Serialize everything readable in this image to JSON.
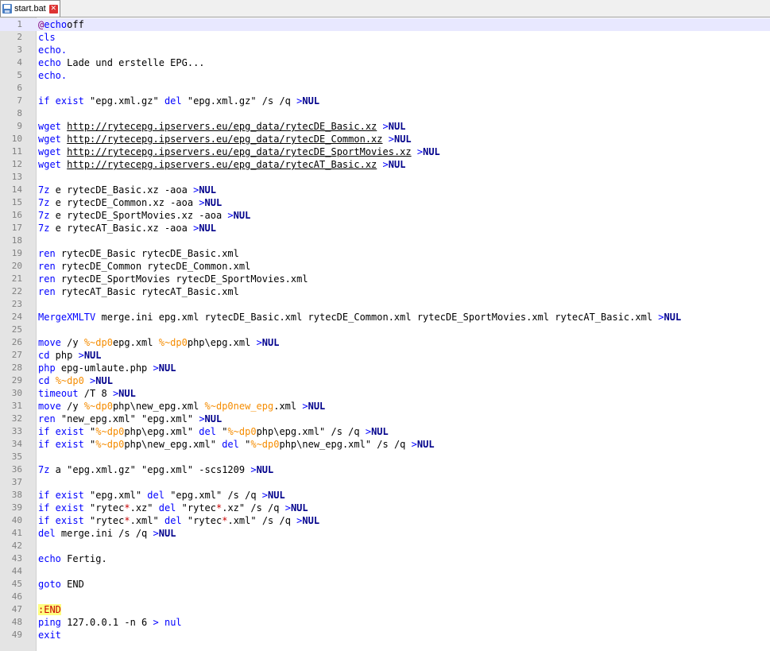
{
  "tab": {
    "label": "start.bat",
    "icon": "save-disk-icon",
    "close_icon": "close-icon"
  },
  "colors": {
    "command": "#0000ff",
    "keyword": "#00008b",
    "variable": "#f58c00",
    "label": "#c80000",
    "line_number": "#808080"
  },
  "current_line": 1,
  "lines": [
    {
      "n": "1",
      "t": [
        [
          "at",
          "@"
        ],
        [
          "kw",
          "echo"
        ],
        [
          "",
          "off"
        ]
      ]
    },
    {
      "n": "2",
      "t": [
        [
          "kw",
          "cls"
        ]
      ]
    },
    {
      "n": "3",
      "t": [
        [
          "kw",
          "echo."
        ]
      ]
    },
    {
      "n": "4",
      "t": [
        [
          "kw",
          "echo"
        ],
        [
          "",
          " Lade und erstelle EPG..."
        ]
      ]
    },
    {
      "n": "5",
      "t": [
        [
          "kw",
          "echo."
        ]
      ]
    },
    {
      "n": "6",
      "t": []
    },
    {
      "n": "7",
      "t": [
        [
          "kw",
          "if exist"
        ],
        [
          "",
          " \"epg.xml.gz\" "
        ],
        [
          "kw",
          "del"
        ],
        [
          "",
          " \"epg.xml.gz\" /s /q "
        ],
        [
          "kw",
          ">"
        ],
        [
          "kb",
          "NUL"
        ]
      ]
    },
    {
      "n": "8",
      "t": []
    },
    {
      "n": "9",
      "t": [
        [
          "kw",
          "wget"
        ],
        [
          "",
          " "
        ],
        [
          "ul",
          "http://rytecepg.ipservers.eu/epg_data/rytecDE_Basic.xz"
        ],
        [
          "",
          " "
        ],
        [
          "kw",
          ">"
        ],
        [
          "kb",
          "NUL"
        ]
      ]
    },
    {
      "n": "10",
      "t": [
        [
          "kw",
          "wget"
        ],
        [
          "",
          " "
        ],
        [
          "ul",
          "http://rytecepg.ipservers.eu/epg_data/rytecDE_Common.xz"
        ],
        [
          "",
          " "
        ],
        [
          "kw",
          ">"
        ],
        [
          "kb",
          "NUL"
        ]
      ]
    },
    {
      "n": "11",
      "t": [
        [
          "kw",
          "wget"
        ],
        [
          "",
          " "
        ],
        [
          "ul",
          "http://rytecepg.ipservers.eu/epg_data/rytecDE_SportMovies.xz"
        ],
        [
          "",
          " "
        ],
        [
          "kw",
          ">"
        ],
        [
          "kb",
          "NUL"
        ]
      ]
    },
    {
      "n": "12",
      "t": [
        [
          "kw",
          "wget"
        ],
        [
          "",
          " "
        ],
        [
          "ul",
          "http://rytecepg.ipservers.eu/epg_data/rytecAT_Basic.xz"
        ],
        [
          "",
          " "
        ],
        [
          "kw",
          ">"
        ],
        [
          "kb",
          "NUL"
        ]
      ]
    },
    {
      "n": "13",
      "t": []
    },
    {
      "n": "14",
      "t": [
        [
          "kw",
          "7z"
        ],
        [
          "",
          " e rytecDE_Basic.xz -aoa "
        ],
        [
          "kw",
          ">"
        ],
        [
          "kb",
          "NUL"
        ]
      ]
    },
    {
      "n": "15",
      "t": [
        [
          "kw",
          "7z"
        ],
        [
          "",
          " e rytecDE_Common.xz -aoa "
        ],
        [
          "kw",
          ">"
        ],
        [
          "kb",
          "NUL"
        ]
      ]
    },
    {
      "n": "16",
      "t": [
        [
          "kw",
          "7z"
        ],
        [
          "",
          " e rytecDE_SportMovies.xz -aoa "
        ],
        [
          "kw",
          ">"
        ],
        [
          "kb",
          "NUL"
        ]
      ]
    },
    {
      "n": "17",
      "t": [
        [
          "kw",
          "7z"
        ],
        [
          "",
          " e rytecAT_Basic.xz -aoa "
        ],
        [
          "kw",
          ">"
        ],
        [
          "kb",
          "NUL"
        ]
      ]
    },
    {
      "n": "18",
      "t": []
    },
    {
      "n": "19",
      "t": [
        [
          "kw",
          "ren"
        ],
        [
          "",
          " rytecDE_Basic rytecDE_Basic.xml"
        ]
      ]
    },
    {
      "n": "20",
      "t": [
        [
          "kw",
          "ren"
        ],
        [
          "",
          " rytecDE_Common rytecDE_Common.xml"
        ]
      ]
    },
    {
      "n": "21",
      "t": [
        [
          "kw",
          "ren"
        ],
        [
          "",
          " rytecDE_SportMovies rytecDE_SportMovies.xml"
        ]
      ]
    },
    {
      "n": "22",
      "t": [
        [
          "kw",
          "ren"
        ],
        [
          "",
          " rytecAT_Basic rytecAT_Basic.xml"
        ]
      ]
    },
    {
      "n": "23",
      "t": []
    },
    {
      "n": "24",
      "t": [
        [
          "kw",
          "MergeXMLTV"
        ],
        [
          "",
          " merge.ini epg.xml rytecDE_Basic.xml rytecDE_Common.xml rytecDE_SportMovies.xml rytecAT_Basic.xml "
        ],
        [
          "kw",
          ">"
        ],
        [
          "kb",
          "NUL"
        ]
      ]
    },
    {
      "n": "25",
      "t": []
    },
    {
      "n": "26",
      "t": [
        [
          "kw",
          "move"
        ],
        [
          "",
          " /y "
        ],
        [
          "vr",
          "%~dp0"
        ],
        [
          "",
          "epg.xml "
        ],
        [
          "vr",
          "%~dp0"
        ],
        [
          "",
          "php\\epg.xml "
        ],
        [
          "kw",
          ">"
        ],
        [
          "kb",
          "NUL"
        ]
      ]
    },
    {
      "n": "27",
      "t": [
        [
          "kw",
          "cd"
        ],
        [
          "",
          " php "
        ],
        [
          "kw",
          ">"
        ],
        [
          "kb",
          "NUL"
        ]
      ]
    },
    {
      "n": "28",
      "t": [
        [
          "kw",
          "php"
        ],
        [
          "",
          " epg-umlaute.php "
        ],
        [
          "kw",
          ">"
        ],
        [
          "kb",
          "NUL"
        ]
      ]
    },
    {
      "n": "29",
      "t": [
        [
          "kw",
          "cd"
        ],
        [
          "",
          " "
        ],
        [
          "vr",
          "%~dp0"
        ],
        [
          "",
          " "
        ],
        [
          "kw",
          ">"
        ],
        [
          "kb",
          "NUL"
        ]
      ]
    },
    {
      "n": "30",
      "t": [
        [
          "kw",
          "timeout"
        ],
        [
          "",
          " /T 8 "
        ],
        [
          "kw",
          ">"
        ],
        [
          "kb",
          "NUL"
        ]
      ]
    },
    {
      "n": "31",
      "t": [
        [
          "kw",
          "move"
        ],
        [
          "",
          " /y "
        ],
        [
          "vr",
          "%~dp0"
        ],
        [
          "",
          "php\\new_epg.xml "
        ],
        [
          "vr",
          "%~dp0"
        ],
        [
          "vr",
          "new_epg"
        ],
        [
          "",
          ".xml "
        ],
        [
          "kw",
          ">"
        ],
        [
          "kb",
          "NUL"
        ]
      ]
    },
    {
      "n": "32",
      "t": [
        [
          "kw",
          "ren"
        ],
        [
          "",
          " \"new_epg.xml\" \"epg.xml\" "
        ],
        [
          "kw",
          ">"
        ],
        [
          "kb",
          "NUL"
        ]
      ]
    },
    {
      "n": "33",
      "t": [
        [
          "kw",
          "if exist"
        ],
        [
          "",
          " \""
        ],
        [
          "vr",
          "%~dp0"
        ],
        [
          "",
          "php\\epg.xml\" "
        ],
        [
          "kw",
          "del"
        ],
        [
          "",
          " \""
        ],
        [
          "vr",
          "%~dp0"
        ],
        [
          "",
          "php\\epg.xml\" /s /q "
        ],
        [
          "kw",
          ">"
        ],
        [
          "kb",
          "NUL"
        ]
      ]
    },
    {
      "n": "34",
      "t": [
        [
          "kw",
          "if exist"
        ],
        [
          "",
          " \""
        ],
        [
          "vr",
          "%~dp0"
        ],
        [
          "",
          "php\\new_epg.xml\" "
        ],
        [
          "kw",
          "del"
        ],
        [
          "",
          " \""
        ],
        [
          "vr",
          "%~dp0"
        ],
        [
          "",
          "php\\new_epg.xml\" /s /q "
        ],
        [
          "kw",
          ">"
        ],
        [
          "kb",
          "NUL"
        ]
      ]
    },
    {
      "n": "35",
      "t": []
    },
    {
      "n": "36",
      "t": [
        [
          "kw",
          "7z"
        ],
        [
          "",
          " a \"epg.xml.gz\" \"epg.xml\" -scs1209 "
        ],
        [
          "kw",
          ">"
        ],
        [
          "kb",
          "NUL"
        ]
      ]
    },
    {
      "n": "37",
      "t": []
    },
    {
      "n": "38",
      "t": [
        [
          "kw",
          "if exist"
        ],
        [
          "",
          " \"epg.xml\" "
        ],
        [
          "kw",
          "del"
        ],
        [
          "",
          " \"epg.xml\" /s /q "
        ],
        [
          "kw",
          ">"
        ],
        [
          "kb",
          "NUL"
        ]
      ]
    },
    {
      "n": "39",
      "t": [
        [
          "kw",
          "if exist"
        ],
        [
          "",
          " \"rytec"
        ],
        [
          "lb2",
          "*"
        ],
        [
          "",
          ".xz\" "
        ],
        [
          "kw",
          "del"
        ],
        [
          "",
          " \"rytec"
        ],
        [
          "lb2",
          "*"
        ],
        [
          "",
          ".xz\" /s /q "
        ],
        [
          "kw",
          ">"
        ],
        [
          "kb",
          "NUL"
        ]
      ]
    },
    {
      "n": "40",
      "t": [
        [
          "kw",
          "if exist"
        ],
        [
          "",
          " \"rytec"
        ],
        [
          "lb2",
          "*"
        ],
        [
          "",
          ".xml\" "
        ],
        [
          "kw",
          "del"
        ],
        [
          "",
          " \"rytec"
        ],
        [
          "lb2",
          "*"
        ],
        [
          "",
          ".xml\" /s /q "
        ],
        [
          "kw",
          ">"
        ],
        [
          "kb",
          "NUL"
        ]
      ]
    },
    {
      "n": "41",
      "t": [
        [
          "kw",
          "del"
        ],
        [
          "",
          " merge.ini /s /q "
        ],
        [
          "kw",
          ">"
        ],
        [
          "kb",
          "NUL"
        ]
      ]
    },
    {
      "n": "42",
      "t": []
    },
    {
      "n": "43",
      "t": [
        [
          "kw",
          "echo"
        ],
        [
          "",
          " Fertig."
        ]
      ]
    },
    {
      "n": "44",
      "t": []
    },
    {
      "n": "45",
      "t": [
        [
          "kw",
          "goto"
        ],
        [
          "",
          " END"
        ]
      ]
    },
    {
      "n": "46",
      "t": []
    },
    {
      "n": "47",
      "t": [
        [
          "lb",
          ":END"
        ]
      ]
    },
    {
      "n": "48",
      "t": [
        [
          "kw",
          "ping"
        ],
        [
          "",
          " 127.0.0.1 -n 6 "
        ],
        [
          "kw",
          ">"
        ],
        [
          "",
          " "
        ],
        [
          "kw",
          "nul"
        ]
      ]
    },
    {
      "n": "49",
      "t": [
        [
          "kw",
          "exit"
        ]
      ]
    }
  ]
}
